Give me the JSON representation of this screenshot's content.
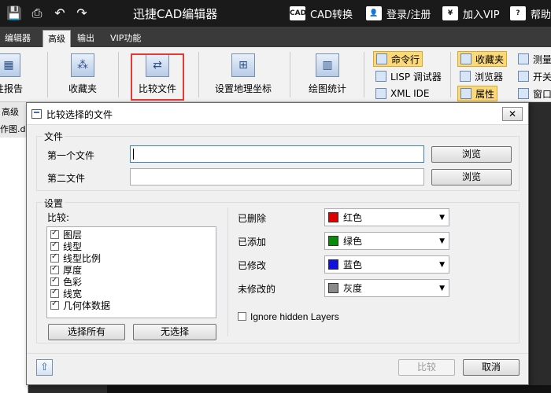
{
  "app": {
    "title": "迅捷CAD编辑器",
    "cad_badge": "CAD",
    "cad_convert": "CAD转换",
    "login": "登录/注册",
    "vip_badge": "¥",
    "vip": "加入VIP",
    "help_badge": "?",
    "help": "帮助"
  },
  "ribbon": {
    "tabs": [
      "编辑器",
      "高级",
      "输出",
      "VIP功能"
    ],
    "active_tab": "高级",
    "report_label": "性报告",
    "favorites_label": "收藏夹",
    "compare_label": "比较文件",
    "geo_label": "设置地理坐标",
    "stats_label": "绘图统计",
    "cmdline_label": "命令行",
    "lisp_label": "LISP 调试器",
    "xml_label": "XML IDE",
    "fav_small_label": "收藏夹",
    "browser_label": "浏览器",
    "props_label": "属性",
    "measure_label": "测量",
    "switch_label": "开关",
    "window_label": "窗口",
    "group_label": "高级",
    "doc_tab": "作图.dw"
  },
  "dialog": {
    "title": "比较选择的文件",
    "close_glyph": "✕",
    "files_group": "文件",
    "first_file_label": "第一个文件",
    "second_file_label": "第二文件",
    "first_file_value": "",
    "second_file_value": "",
    "browse_label": "浏览",
    "settings_group": "设置",
    "compare_label": "比较:",
    "items": [
      {
        "label": "图层",
        "checked": true
      },
      {
        "label": "线型",
        "checked": true
      },
      {
        "label": "线型比例",
        "checked": true
      },
      {
        "label": "厚度",
        "checked": true
      },
      {
        "label": "色彩",
        "checked": true
      },
      {
        "label": "线宽",
        "checked": true
      },
      {
        "label": "几何体数据",
        "checked": true
      }
    ],
    "select_all": "选择所有",
    "select_none": "无选择",
    "deleted_label": "已删除",
    "added_label": "已添加",
    "modified_label": "已修改",
    "unmodified_label": "未修改的",
    "deleted_color": {
      "name": "红色",
      "hex": "#e00000"
    },
    "added_color": {
      "name": "绿色",
      "hex": "#0a8a0a"
    },
    "modified_color": {
      "name": "蓝色",
      "hex": "#1010e0"
    },
    "unmodified_color": {
      "name": "灰度",
      "hex": "#8a8a8a"
    },
    "ignore_hidden": "Ignore hidden Layers",
    "ignore_hidden_checked": false,
    "ok_label": "比较",
    "cancel_label": "取消",
    "help_icon": "up-arrow-icon"
  }
}
